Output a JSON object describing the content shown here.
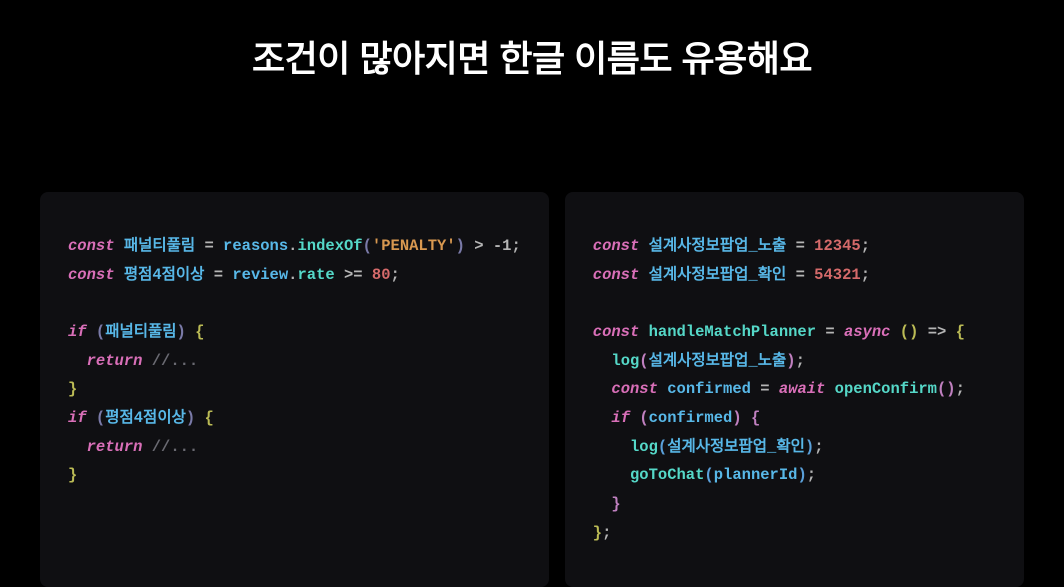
{
  "title": "조건이 많아지면 한글 이름도 유용해요",
  "left": {
    "kw_const1": "const",
    "var1": "패널티풀림",
    "eq": " = ",
    "obj1": "reasons",
    "dot": ".",
    "fn_indexOf": "indexOf",
    "lp": "(",
    "str_penalty": "'PENALTY'",
    "rp": ")",
    "gt": " > ",
    "neg1": "-1",
    "semi": ";",
    "kw_const2": "const",
    "var2": "평점4점이상",
    "obj2": "review",
    "prop_rate": "rate",
    "gte": " >= ",
    "num80": "80",
    "kw_if1": "if",
    "cond1": "패널티풀림",
    "brace_o": "{",
    "kw_return": "return",
    "comment_ellipsis": " //...",
    "brace_c": "}",
    "kw_if2": "if",
    "cond2": "평점4점이상"
  },
  "right": {
    "kw_const1": "const",
    "var1": "설계사정보팝업_노출",
    "eq": " = ",
    "num1": "12345",
    "semi": ";",
    "kw_const2": "const",
    "var2": "설계사정보팝업_확인",
    "num2": "54321",
    "kw_const3": "const",
    "fn_handle": "handleMatchPlanner",
    "kw_async": "async",
    "arrow_p": "()",
    "arrow": " => ",
    "brace_o": "{",
    "fn_log": "log",
    "lp": "(",
    "arg1": "설계사정보팝업_노출",
    "rp": ")",
    "kw_const4": "const",
    "var_conf": "confirmed",
    "kw_await": "await",
    "fn_open": "openConfirm",
    "call_empty": "()",
    "kw_if": "if",
    "cond": "confirmed",
    "arg2": "설계사정보팝업_확인",
    "fn_goto": "goToChat",
    "arg3": "plannerId",
    "brace_c": "}",
    "brace_c2": "}",
    "final_semi": ";"
  }
}
